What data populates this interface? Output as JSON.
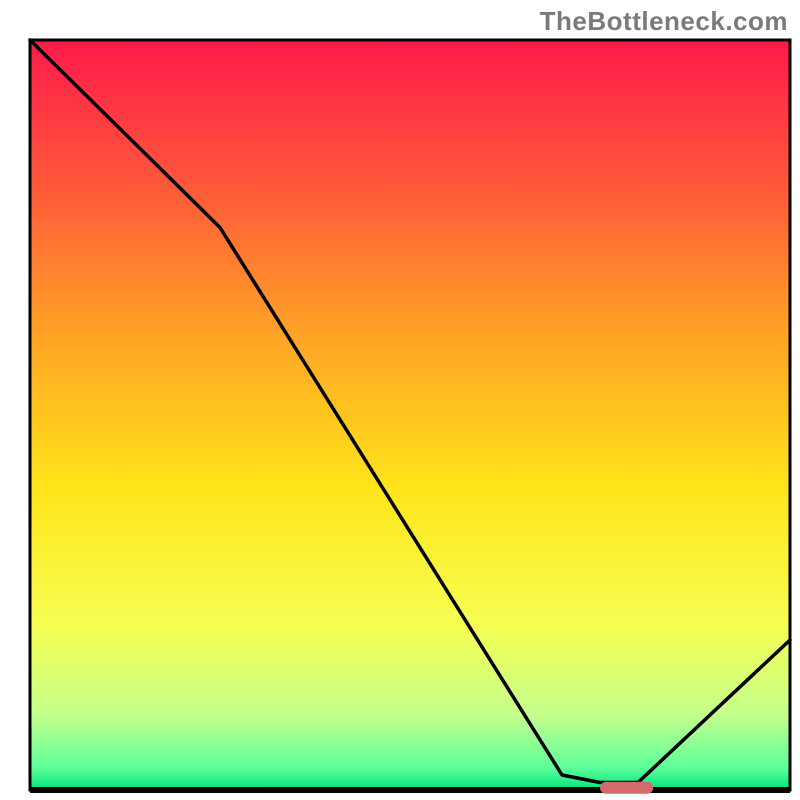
{
  "watermark": "TheBottleneck.com",
  "chart_data": {
    "type": "line",
    "title": "",
    "xlabel": "",
    "ylabel": "",
    "xlim": [
      0,
      100
    ],
    "ylim": [
      0,
      100
    ],
    "grid": false,
    "legend": false,
    "background_gradient": {
      "direction": "vertical",
      "stops": [
        {
          "pos": 0.0,
          "color": "#ff1a4b"
        },
        {
          "pos": 0.2,
          "color": "#ff5a3a"
        },
        {
          "pos": 0.4,
          "color": "#ffa624"
        },
        {
          "pos": 0.6,
          "color": "#ffe51a"
        },
        {
          "pos": 0.78,
          "color": "#f6ff52"
        },
        {
          "pos": 0.9,
          "color": "#c4ff8c"
        },
        {
          "pos": 0.97,
          "color": "#5eff9a"
        },
        {
          "pos": 1.0,
          "color": "#00e47a"
        }
      ]
    },
    "series": [
      {
        "name": "bottleneck-curve",
        "color": "#000000",
        "x": [
          0,
          25,
          70,
          75,
          80,
          100
        ],
        "y": [
          100,
          75,
          2,
          1,
          1,
          20
        ]
      }
    ],
    "marker": {
      "name": "optimal-range",
      "color": "#d46a6a",
      "x_start": 75,
      "x_end": 82,
      "y": 0.3
    }
  }
}
